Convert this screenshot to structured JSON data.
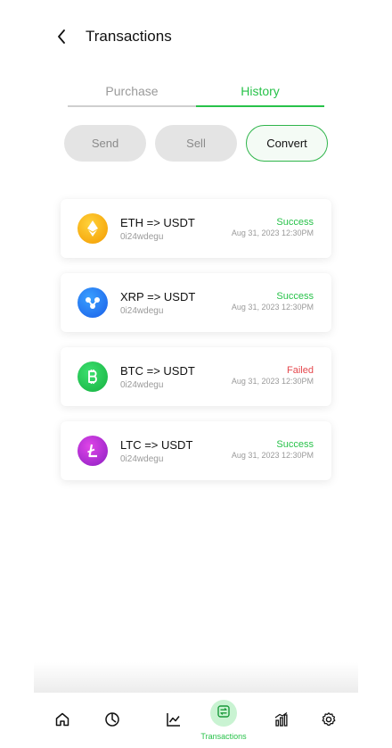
{
  "header": {
    "title": "Transactions"
  },
  "tabs": [
    {
      "label": "Purchase",
      "active": false
    },
    {
      "label": "History",
      "active": true
    }
  ],
  "filters": [
    {
      "label": "Send",
      "active": false
    },
    {
      "label": "Sell",
      "active": false
    },
    {
      "label": "Convert",
      "active": true
    }
  ],
  "transactions": [
    {
      "coin_icon": "ethereum-icon",
      "coin_color": "#f5a000",
      "pair": "ETH => USDT",
      "id": "0i24wdegu",
      "status": "Success",
      "status_color": "#28c24a",
      "datetime": "Aug 31, 2023 12:30PM"
    },
    {
      "coin_icon": "ripple-icon",
      "coin_color": "#1e6df5",
      "pair": "XRP => USDT",
      "id": "0i24wdegu",
      "status": "Success",
      "status_color": "#28c24a",
      "datetime": "Aug 31, 2023 12:30PM"
    },
    {
      "coin_icon": "bitcoin-icon",
      "coin_color": "#1fc14a",
      "pair": "BTC => USDT",
      "id": "0i24wdegu",
      "status": "Failed",
      "status_color": "#e5484d",
      "datetime": "Aug 31, 2023 12:30PM"
    },
    {
      "coin_icon": "litecoin-icon",
      "coin_color": "#b52ad4",
      "pair": "LTC => USDT",
      "id": "0i24wdegu",
      "status": "Success",
      "status_color": "#28c24a",
      "datetime": "Aug 31, 2023 12:30PM"
    }
  ],
  "bottom_nav": {
    "items": [
      {
        "icon": "home-icon"
      },
      {
        "icon": "clock-icon"
      },
      {
        "icon": "chart-line-icon"
      },
      {
        "icon": "transactions-icon",
        "label": "Transactions",
        "active": true
      },
      {
        "icon": "bar-chart-icon"
      },
      {
        "icon": "settings-icon"
      }
    ]
  },
  "colors": {
    "accent": "#28c24a",
    "failed": "#e5484d"
  }
}
